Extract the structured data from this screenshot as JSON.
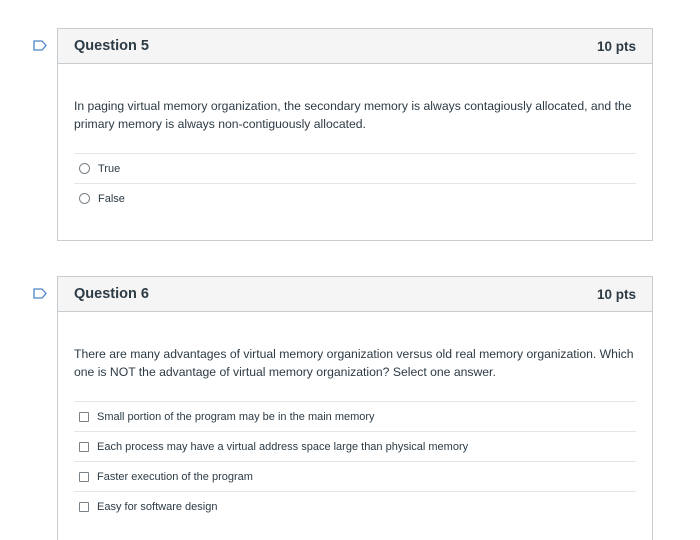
{
  "questions": [
    {
      "title": "Question 5",
      "points": "10 pts",
      "text": "In paging virtual memory organization, the secondary memory is always contagiously allocated, and the primary memory is always non-contiguously allocated.",
      "answer_type": "radio",
      "answers": [
        "True",
        "False"
      ]
    },
    {
      "title": "Question 6",
      "points": "10 pts",
      "text": "There are many advantages of virtual memory organization versus old real memory organization. Which one is NOT the advantage of virtual memory organization? Select one answer.",
      "answer_type": "checkbox",
      "answers": [
        "Small portion of the program may be in the main memory",
        "Each process may have a virtual address space large than physical memory",
        "Faster execution of the program",
        "Easy for software design"
      ]
    }
  ],
  "colors": {
    "flag": "#4a86c8",
    "border": "#c7cdd1",
    "header_bg": "#f5f5f5",
    "text": "#2d3b45"
  },
  "icons": {
    "flag": "bookmark-flag-icon",
    "radio": "radio-button",
    "checkbox": "checkbox"
  }
}
